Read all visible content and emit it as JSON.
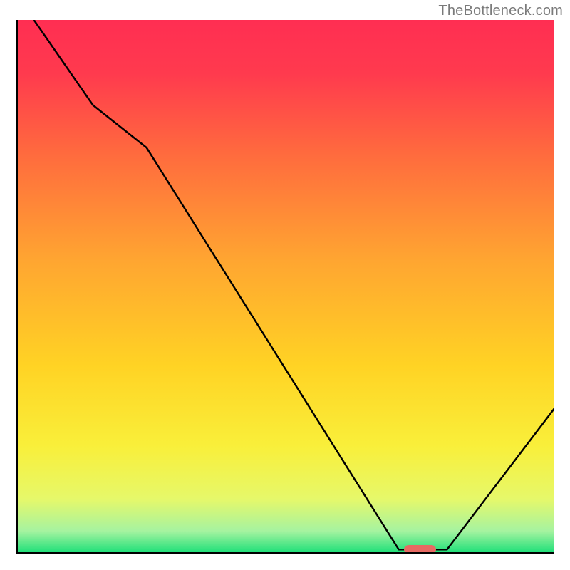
{
  "watermark": "TheBottleneck.com",
  "chart_data": {
    "type": "line",
    "title": "",
    "xlabel": "",
    "ylabel": "",
    "xlim": [
      0,
      100
    ],
    "ylim": [
      0,
      100
    ],
    "grid": false,
    "background_gradient": [
      {
        "offset": 0.0,
        "color": "#ff2e52"
      },
      {
        "offset": 0.1,
        "color": "#ff3a4e"
      },
      {
        "offset": 0.25,
        "color": "#ff6a3e"
      },
      {
        "offset": 0.45,
        "color": "#ffa531"
      },
      {
        "offset": 0.65,
        "color": "#ffd324"
      },
      {
        "offset": 0.8,
        "color": "#f9ef3a"
      },
      {
        "offset": 0.9,
        "color": "#e6f86a"
      },
      {
        "offset": 0.96,
        "color": "#a6f3a0"
      },
      {
        "offset": 1.0,
        "color": "#22e07a"
      }
    ],
    "series": [
      {
        "name": "bottleneck-curve",
        "x": [
          3.0,
          14.0,
          24.0,
          71.0,
          80.0,
          100.0
        ],
        "values": [
          100.0,
          84.0,
          76.0,
          0.5,
          0.5,
          27.0
        ],
        "stroke": "#000000",
        "stroke_width": 2.5
      }
    ],
    "marker": {
      "x": 75.0,
      "y": 0.5,
      "width_pct": 6.0,
      "height_pct": 1.8,
      "color": "#e76a63",
      "shape": "pill"
    }
  }
}
